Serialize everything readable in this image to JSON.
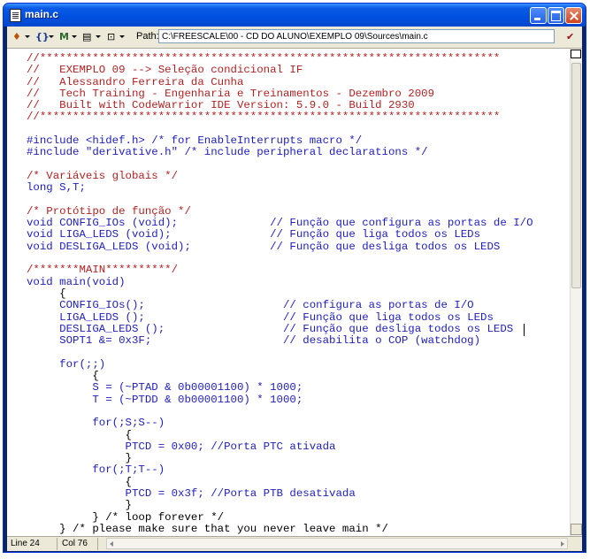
{
  "window": {
    "title": "main.c"
  },
  "toolbar": {
    "path_label": "Path:",
    "path_value": "C:\\FREESCALE\\00 - CD DO ALUNO\\EXEMPLO 09\\Sources\\main.c",
    "buttons": [
      "make-icon",
      "functions-icon",
      "markers-icon",
      "document-settings-icon",
      "version-control-icon"
    ]
  },
  "editor": {
    "lines": [
      {
        "cls": "c",
        "text": "//**********************************************************************"
      },
      {
        "cls": "c",
        "text": "//   EXEMPLO 09 --> Seleção condicional IF"
      },
      {
        "cls": "c",
        "text": "//   Alessandro Ferreira da Cunha"
      },
      {
        "cls": "c",
        "text": "//   Tech Training - Engenharia e Treinamentos - Dezembro 2009"
      },
      {
        "cls": "c",
        "text": "//   Built with CodeWarrior IDE Version: 5.9.0 - Build 2930"
      },
      {
        "cls": "c",
        "text": "//**********************************************************************"
      },
      {
        "cls": "t",
        "text": ""
      },
      {
        "cls": "k",
        "text": "#include <hidef.h> /* for EnableInterrupts macro */"
      },
      {
        "cls": "k",
        "text": "#include \"derivative.h\" /* include peripheral declarations */"
      },
      {
        "cls": "t",
        "text": ""
      },
      {
        "cls": "c",
        "text": "/* Variáveis globais */"
      },
      {
        "cls": "k",
        "text": "long S,T;"
      },
      {
        "cls": "t",
        "text": ""
      },
      {
        "cls": "c",
        "text": "/* Protótipo de função */"
      },
      {
        "cls": "k",
        "text": "void CONFIG_IOs (void);              // Função que configura as portas de I/O"
      },
      {
        "cls": "k",
        "text": "void LIGA_LEDS (void);               // Função que liga todos os LEDs"
      },
      {
        "cls": "k",
        "text": "void DESLIGA_LEDS (void);            // Função que desliga todos os LEDS"
      },
      {
        "cls": "t",
        "text": ""
      },
      {
        "cls": "c",
        "text": "/*******MAIN**********/"
      },
      {
        "cls": "k",
        "text": "void main(void)"
      },
      {
        "cls": "t",
        "text": "     {"
      },
      {
        "cls": "f",
        "text": "     CONFIG_IOs();                     // configura as portas de I/O"
      },
      {
        "cls": "f",
        "text": "     LIGA_LEDS ();                     // Função que liga todos os LEDs"
      },
      {
        "cls": "f",
        "text": "     DESLIGA_LEDS ();                  // Função que desliga todos os LEDS"
      },
      {
        "cls": "f",
        "text": "     SOPT1 &= 0x3F;                    // desabilita o COP (watchdog)"
      },
      {
        "cls": "t",
        "text": ""
      },
      {
        "cls": "k",
        "text": "     for(;;)"
      },
      {
        "cls": "t",
        "text": "          {"
      },
      {
        "cls": "f",
        "text": "          S = (~PTAD & 0b00001100) * 1000;"
      },
      {
        "cls": "f",
        "text": "          T = (~PTDD & 0b00001100) * 1000;"
      },
      {
        "cls": "t",
        "text": ""
      },
      {
        "cls": "k",
        "text": "          for(;S;S--)"
      },
      {
        "cls": "t",
        "text": "               {"
      },
      {
        "cls": "f",
        "text": "               PTCD = 0x00; //Porta PTC ativada"
      },
      {
        "cls": "t",
        "text": "               }"
      },
      {
        "cls": "k",
        "text": "          for(;T;T--)"
      },
      {
        "cls": "t",
        "text": "               {"
      },
      {
        "cls": "f",
        "text": "               PTCD = 0x3f; //Porta PTB desativada"
      },
      {
        "cls": "t",
        "text": "               }"
      },
      {
        "cls": "t",
        "text": "          } /* loop forever */"
      },
      {
        "cls": "t",
        "text": "     } /* please make sure that you never leave main */"
      }
    ]
  },
  "status": {
    "line": "Line 24",
    "col": "Col 76"
  }
}
